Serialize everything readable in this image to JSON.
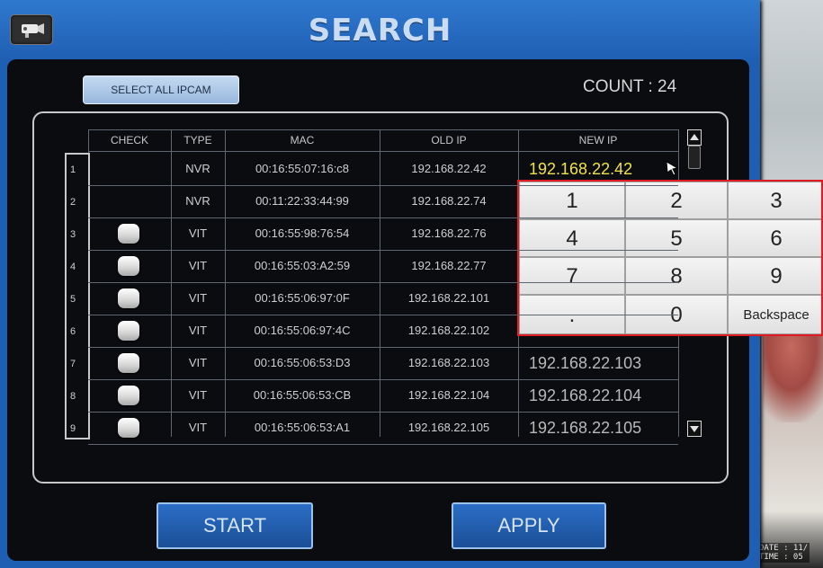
{
  "window": {
    "title": "SEARCH",
    "logo_icon": "camera-icon"
  },
  "toolbar": {
    "select_all_label": "SELECT ALL IPCAM",
    "count_label": "COUNT : 24"
  },
  "table": {
    "headers": {
      "check": "CHECK",
      "type": "TYPE",
      "mac": "MAC",
      "old_ip": "OLD IP",
      "new_ip": "NEW IP"
    },
    "rows": [
      {
        "index": "1",
        "has_checkbox": false,
        "type": "NVR",
        "mac": "00:16:55:07:16:c8",
        "old_ip": "192.168.22.42",
        "new_ip": "192.168.22.42",
        "editing": true
      },
      {
        "index": "2",
        "has_checkbox": false,
        "type": "NVR",
        "mac": "00:11:22:33:44:99",
        "old_ip": "192.168.22.74",
        "new_ip": ""
      },
      {
        "index": "3",
        "has_checkbox": true,
        "type": "VIT",
        "mac": "00:16:55:98:76:54",
        "old_ip": "192.168.22.76",
        "new_ip": ""
      },
      {
        "index": "4",
        "has_checkbox": true,
        "type": "VIT",
        "mac": "00:16:55:03:A2:59",
        "old_ip": "192.168.22.77",
        "new_ip": ""
      },
      {
        "index": "5",
        "has_checkbox": true,
        "type": "VIT",
        "mac": "00:16:55:06:97:0F",
        "old_ip": "192.168.22.101",
        "new_ip": ""
      },
      {
        "index": "6",
        "has_checkbox": true,
        "type": "VIT",
        "mac": "00:16:55:06:97:4C",
        "old_ip": "192.168.22.102",
        "new_ip": ""
      },
      {
        "index": "7",
        "has_checkbox": true,
        "type": "VIT",
        "mac": "00:16:55:06:53:D3",
        "old_ip": "192.168.22.103",
        "new_ip": "192.168.22.103"
      },
      {
        "index": "8",
        "has_checkbox": true,
        "type": "VIT",
        "mac": "00:16:55:06:53:CB",
        "old_ip": "192.168.22.104",
        "new_ip": "192.168.22.104"
      },
      {
        "index": "9",
        "has_checkbox": true,
        "type": "VIT",
        "mac": "00:16:55:06:53:A1",
        "old_ip": "192.168.22.105",
        "new_ip": "192.168.22.105"
      }
    ]
  },
  "keypad": {
    "keys": [
      "1",
      "2",
      "3",
      "4",
      "5",
      "6",
      "7",
      "8",
      "9",
      ".",
      "0",
      "Backspace"
    ]
  },
  "footer": {
    "start_label": "START",
    "apply_label": "APPLY"
  },
  "feed": {
    "osd_line1": "DATE : 11/",
    "osd_line2": "TIME : 05"
  },
  "colors": {
    "window_blue": "#1f5fb3",
    "panel_black": "#0a0c10",
    "editing_text": "#f0e24a",
    "keypad_border": "#e01b24"
  }
}
